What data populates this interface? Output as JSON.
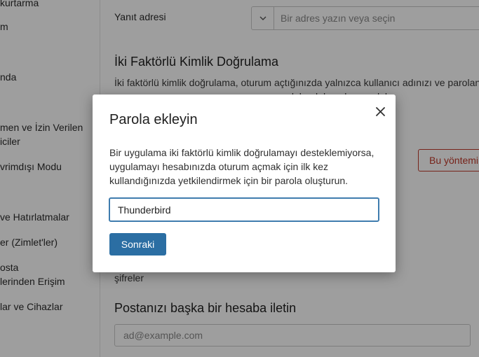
{
  "sidebar": {
    "items": [
      "kurtarma",
      "m",
      "nda",
      "men ve İzin Verilen",
      "iciler",
      "vrimdışı Modu",
      "ve Hatırlatmalar",
      "er (Zimlet'ler)",
      "osta",
      "lerinden Erişim",
      "lar ve Cihazlar"
    ]
  },
  "main": {
    "reply_label": "Yanıt adresi",
    "reply_select": {
      "placeholder": "Bir adres yazın veya seçin"
    },
    "twofa_heading": "İki Faktörlü Kimlik Doğrulama",
    "twofa_line1": "İki faktörlü kimlik doğrulama, oturum açtığınızda yalnızca kullanıcı adınızı ve parolanızı",
    "twofa_line2": "                                                                 kılarak hesabınıza dah",
    "method_button": "Bu yöntemi",
    "app_passwords_label": "şifreler",
    "forward_heading": "Postanızı başka bir hesaba iletin",
    "forward_input": {
      "placeholder": "ad@example.com"
    }
  },
  "modal": {
    "title": "Parola ekleyin",
    "description_lines": [
      "Bir uygulama iki faktörlü kimlik doğrulamayı desteklemiyorsa,",
      "uygulamayı hesabınızda oturum açmak için ilk kez",
      "kullandığınızda yetkilendirmek için bir parola oluşturun."
    ],
    "input_value": "Thunderbird",
    "next_button": "Sonraki"
  },
  "colors": {
    "accent": "#2b6ea3",
    "focus_border": "#3f7cae",
    "danger": "#c0392b"
  },
  "icons": {
    "close": "close-icon",
    "dropdown": "chevron-down-icon"
  }
}
